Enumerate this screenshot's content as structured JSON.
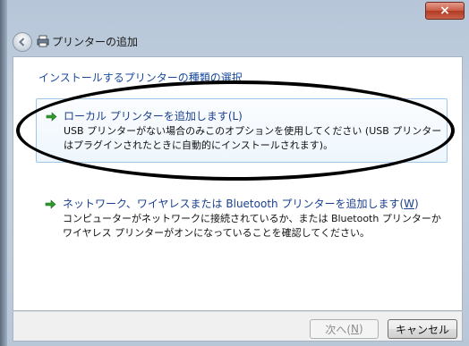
{
  "window": {
    "title": "プリンターの追加",
    "close_glyph": "×"
  },
  "main": {
    "heading": "インストールするプリンターの種類の選択"
  },
  "options": [
    {
      "title": "ローカル プリンターを追加します(L)",
      "description": "USB プリンターがない場合のみこのオプションを使用してください (USB プリンターはプラグインされたときに自動的にインストールされます)。",
      "icon": "green-arrow-icon"
    },
    {
      "title_prefix": "ネットワーク、ワイヤレスまたは Bluetooth プリンターを追加します(",
      "title_mnemonic": "W",
      "title_suffix": ")",
      "description": "コンピューターがネットワークに接続されているか、または Bluetooth プリンターかワイヤレス プリンターがオンになっていることを確認してください。",
      "icon": "green-arrow-icon"
    }
  ],
  "footer": {
    "next_prefix": "次へ(",
    "next_mnemonic": "N",
    "next_suffix": ")",
    "cancel_label": "キャンセル"
  },
  "colors": {
    "heading": "#1a4a9c",
    "option_title": "#1a3f8e",
    "close_button": "#c95a45",
    "arrow": "#2e9a2e"
  }
}
